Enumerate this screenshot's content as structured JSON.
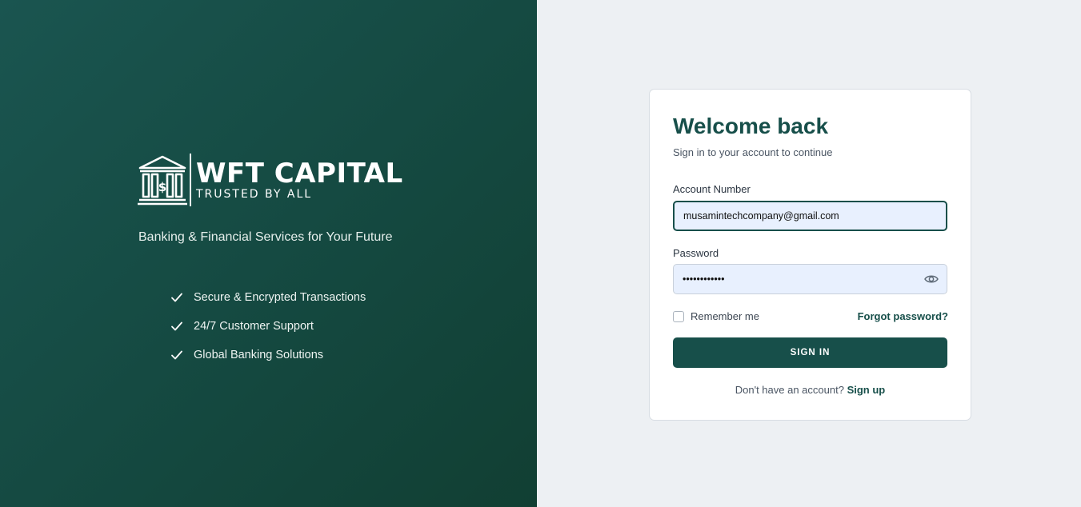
{
  "brand": {
    "name": "WFT CAPITAL",
    "tagline": "TRUSTED BY ALL",
    "icon": "bank-icon"
  },
  "left": {
    "subtitle": "Banking & Financial Services for Your Future",
    "features": [
      "Secure & Encrypted Transactions",
      "24/7 Customer Support",
      "Global Banking Solutions"
    ]
  },
  "login": {
    "title": "Welcome back",
    "subtitle": "Sign in to your account to continue",
    "account_label": "Account Number",
    "account_value": "musamintechcompany@gmail.com",
    "password_label": "Password",
    "password_mask": "••••••••••••",
    "remember_label": "Remember me",
    "forgot_label": "Forgot password?",
    "signin_label": "SIGN IN",
    "signup_prompt": "Don't have an account?",
    "signup_label": "Sign up"
  },
  "colors": {
    "accent": "#174f4a",
    "left_gradient_start": "#1a5550",
    "left_gradient_end": "#113f33",
    "background": "#edf0f3",
    "input_fill": "#e8f0fe"
  }
}
